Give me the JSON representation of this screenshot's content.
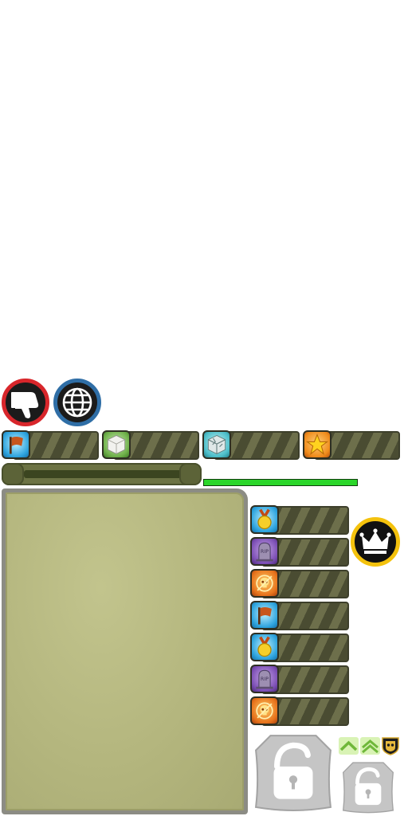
{
  "colors": {
    "dislike_ring": "#d8262b",
    "globe_ring": "#2f6ea6",
    "crown_ring": "#f4c20d",
    "hp_fill": "#2bd62a",
    "panel_parchment": "#b4b67e",
    "bar_hatch": "#6d6f4b"
  },
  "top_buttons": [
    {
      "icon": "thumbs-down-icon"
    },
    {
      "icon": "globe-icon"
    }
  ],
  "resource_bars": [
    {
      "icon": "flag-icon",
      "tint": "blue"
    },
    {
      "icon": "cube-icon",
      "tint": "green"
    },
    {
      "icon": "cracked-cube-icon",
      "tint": "teal"
    },
    {
      "icon": "star-icon",
      "tint": "orange"
    }
  ],
  "health_bar": {
    "fill_fraction": 1.0
  },
  "stat_list": [
    {
      "icon": "medal-icon",
      "tint": "blue"
    },
    {
      "icon": "tombstone-icon",
      "tint": "purple",
      "icon_text": "RIP"
    },
    {
      "icon": "flaming-skull-icon",
      "tint": "fire"
    },
    {
      "icon": "flag-icon",
      "tint": "blue"
    },
    {
      "icon": "medal-icon",
      "tint": "blue"
    },
    {
      "icon": "tombstone-icon",
      "tint": "purple",
      "icon_text": "RIP"
    },
    {
      "icon": "flaming-skull-icon",
      "tint": "fire"
    }
  ],
  "crown_button": {
    "icon": "crown-icon"
  },
  "rank_controls": [
    {
      "icon": "chevron-up-icon"
    },
    {
      "icon": "double-chevron-up-icon"
    },
    {
      "icon": "skull-shield-icon"
    }
  ],
  "locked_slots": [
    {
      "icon": "padlock-icon",
      "size": "large"
    },
    {
      "icon": "padlock-icon",
      "size": "small"
    }
  ]
}
